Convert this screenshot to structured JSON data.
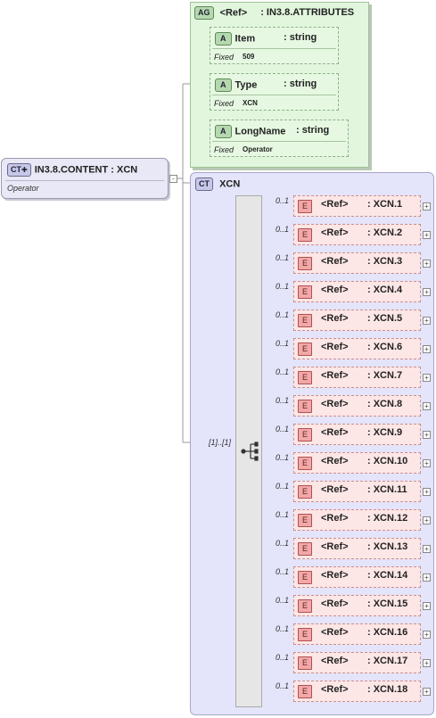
{
  "root": {
    "badge": "CT",
    "name": "IN3.8.CONTENT : XCN",
    "doc": "Operator"
  },
  "attribute_group": {
    "badge": "AG",
    "ref": "<Ref>",
    "type": ": IN3.8.ATTRIBUTES",
    "attributes": [
      {
        "badge": "A",
        "name": "Item",
        "type": ": string",
        "fixed_label": "Fixed",
        "fixed_value": "509"
      },
      {
        "badge": "A",
        "name": "Type",
        "type": ": string",
        "fixed_label": "Fixed",
        "fixed_value": "XCN"
      },
      {
        "badge": "A",
        "name": "LongName",
        "type": ": string",
        "fixed_label": "Fixed",
        "fixed_value": "Operator"
      }
    ]
  },
  "complex_type": {
    "badge": "CT",
    "name": "XCN"
  },
  "sequence": {
    "multiplicity": "[1]..[1]"
  },
  "elements": [
    {
      "badge": "E",
      "mult": "0..1",
      "ref": "<Ref>",
      "type": ": XCN.1"
    },
    {
      "badge": "E",
      "mult": "0..1",
      "ref": "<Ref>",
      "type": ": XCN.2"
    },
    {
      "badge": "E",
      "mult": "0..1",
      "ref": "<Ref>",
      "type": ": XCN.3"
    },
    {
      "badge": "E",
      "mult": "0..1",
      "ref": "<Ref>",
      "type": ": XCN.4"
    },
    {
      "badge": "E",
      "mult": "0..1",
      "ref": "<Ref>",
      "type": ": XCN.5"
    },
    {
      "badge": "E",
      "mult": "0..1",
      "ref": "<Ref>",
      "type": ": XCN.6"
    },
    {
      "badge": "E",
      "mult": "0..1",
      "ref": "<Ref>",
      "type": ": XCN.7"
    },
    {
      "badge": "E",
      "mult": "0..1",
      "ref": "<Ref>",
      "type": ": XCN.8"
    },
    {
      "badge": "E",
      "mult": "0..1",
      "ref": "<Ref>",
      "type": ": XCN.9"
    },
    {
      "badge": "E",
      "mult": "0..1",
      "ref": "<Ref>",
      "type": ": XCN.10"
    },
    {
      "badge": "E",
      "mult": "0..1",
      "ref": "<Ref>",
      "type": ": XCN.11"
    },
    {
      "badge": "E",
      "mult": "0..1",
      "ref": "<Ref>",
      "type": ": XCN.12"
    },
    {
      "badge": "E",
      "mult": "0..1",
      "ref": "<Ref>",
      "type": ": XCN.13"
    },
    {
      "badge": "E",
      "mult": "0..1",
      "ref": "<Ref>",
      "type": ": XCN.14"
    },
    {
      "badge": "E",
      "mult": "0..1",
      "ref": "<Ref>",
      "type": ": XCN.15"
    },
    {
      "badge": "E",
      "mult": "0..1",
      "ref": "<Ref>",
      "type": ": XCN.16"
    },
    {
      "badge": "E",
      "mult": "0..1",
      "ref": "<Ref>",
      "type": ": XCN.17"
    },
    {
      "badge": "E",
      "mult": "0..1",
      "ref": "<Ref>",
      "type": ": XCN.18"
    }
  ],
  "icons": {
    "expand": "plus-icon",
    "sequence": "sequence-icon"
  }
}
